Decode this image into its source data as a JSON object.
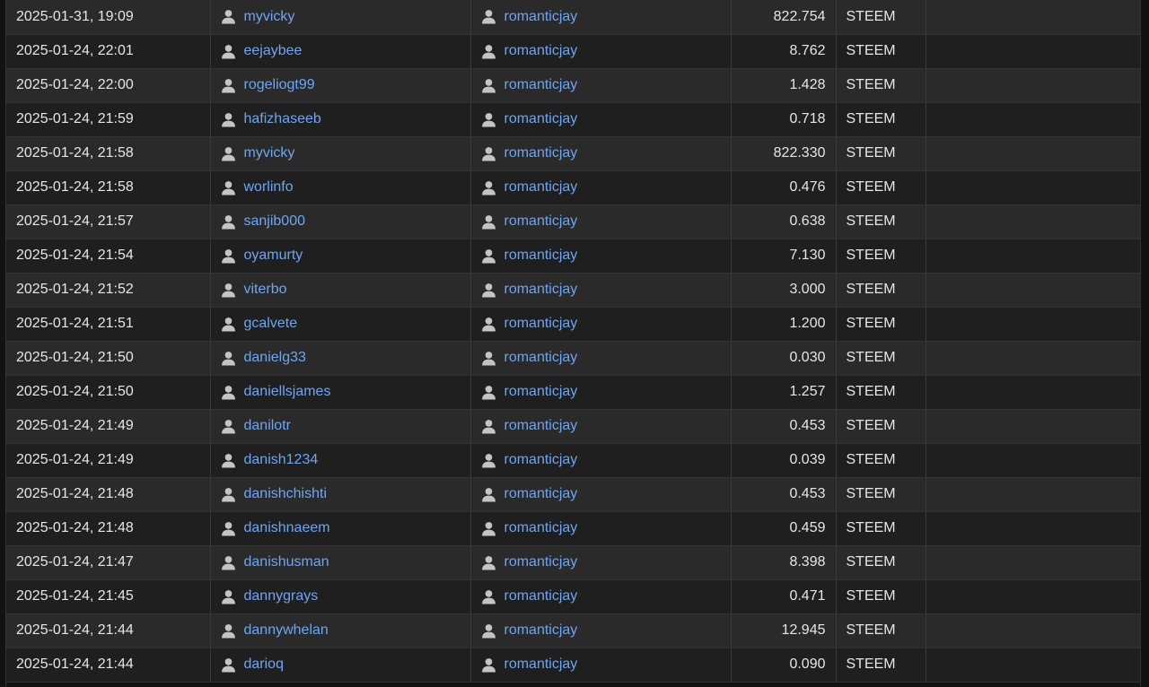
{
  "transfers": [
    {
      "date": "2025-01-31, 19:09",
      "from": "myvicky",
      "to": "romanticjay",
      "amount": "822.754",
      "asset": "STEEM",
      "memo": ""
    },
    {
      "date": "2025-01-24, 22:01",
      "from": "eejaybee",
      "to": "romanticjay",
      "amount": "8.762",
      "asset": "STEEM",
      "memo": ""
    },
    {
      "date": "2025-01-24, 22:00",
      "from": "rogeliogt99",
      "to": "romanticjay",
      "amount": "1.428",
      "asset": "STEEM",
      "memo": ""
    },
    {
      "date": "2025-01-24, 21:59",
      "from": "hafizhaseeb",
      "to": "romanticjay",
      "amount": "0.718",
      "asset": "STEEM",
      "memo": ""
    },
    {
      "date": "2025-01-24, 21:58",
      "from": "myvicky",
      "to": "romanticjay",
      "amount": "822.330",
      "asset": "STEEM",
      "memo": ""
    },
    {
      "date": "2025-01-24, 21:58",
      "from": "worlinfo",
      "to": "romanticjay",
      "amount": "0.476",
      "asset": "STEEM",
      "memo": ""
    },
    {
      "date": "2025-01-24, 21:57",
      "from": "sanjib000",
      "to": "romanticjay",
      "amount": "0.638",
      "asset": "STEEM",
      "memo": ""
    },
    {
      "date": "2025-01-24, 21:54",
      "from": "oyamurty",
      "to": "romanticjay",
      "amount": "7.130",
      "asset": "STEEM",
      "memo": ""
    },
    {
      "date": "2025-01-24, 21:52",
      "from": "viterbo",
      "to": "romanticjay",
      "amount": "3.000",
      "asset": "STEEM",
      "memo": ""
    },
    {
      "date": "2025-01-24, 21:51",
      "from": "gcalvete",
      "to": "romanticjay",
      "amount": "1.200",
      "asset": "STEEM",
      "memo": ""
    },
    {
      "date": "2025-01-24, 21:50",
      "from": "danielg33",
      "to": "romanticjay",
      "amount": "0.030",
      "asset": "STEEM",
      "memo": ""
    },
    {
      "date": "2025-01-24, 21:50",
      "from": "daniellsjames",
      "to": "romanticjay",
      "amount": "1.257",
      "asset": "STEEM",
      "memo": ""
    },
    {
      "date": "2025-01-24, 21:49",
      "from": "danilotr",
      "to": "romanticjay",
      "amount": "0.453",
      "asset": "STEEM",
      "memo": ""
    },
    {
      "date": "2025-01-24, 21:49",
      "from": "danish1234",
      "to": "romanticjay",
      "amount": "0.039",
      "asset": "STEEM",
      "memo": ""
    },
    {
      "date": "2025-01-24, 21:48",
      "from": "danishchishti",
      "to": "romanticjay",
      "amount": "0.453",
      "asset": "STEEM",
      "memo": ""
    },
    {
      "date": "2025-01-24, 21:48",
      "from": "danishnaeem",
      "to": "romanticjay",
      "amount": "0.459",
      "asset": "STEEM",
      "memo": ""
    },
    {
      "date": "2025-01-24, 21:47",
      "from": "danishusman",
      "to": "romanticjay",
      "amount": "8.398",
      "asset": "STEEM",
      "memo": ""
    },
    {
      "date": "2025-01-24, 21:45",
      "from": "dannygrays",
      "to": "romanticjay",
      "amount": "0.471",
      "asset": "STEEM",
      "memo": ""
    },
    {
      "date": "2025-01-24, 21:44",
      "from": "dannywhelan",
      "to": "romanticjay",
      "amount": "12.945",
      "asset": "STEEM",
      "memo": ""
    },
    {
      "date": "2025-01-24, 21:44",
      "from": "darioq",
      "to": "romanticjay",
      "amount": "0.090",
      "asset": "STEEM",
      "memo": ""
    }
  ],
  "icons": {
    "user": "user-icon"
  },
  "colors": {
    "link": "#6fa5f2",
    "row_odd": "#2a2a2a",
    "row_even": "#1f1f1f",
    "icon": "#c4c4c4"
  }
}
